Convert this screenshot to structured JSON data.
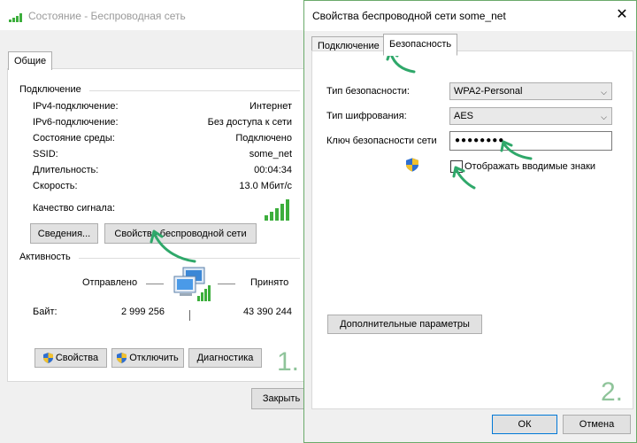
{
  "status_window": {
    "title": "Состояние - Беспроводная сеть",
    "tab_general": "Общие",
    "connection_group": "Подключение",
    "rows": [
      {
        "label": "IPv4-подключение:",
        "value": "Интернет"
      },
      {
        "label": "IPv6-подключение:",
        "value": "Без доступа к сети"
      },
      {
        "label": "Состояние среды:",
        "value": "Подключено"
      },
      {
        "label": "SSID:",
        "value": "some_net"
      },
      {
        "label": "Длительность:",
        "value": "00:04:34"
      },
      {
        "label": "Скорость:",
        "value": "13.0 Мбит/с"
      }
    ],
    "signal_label": "Качество сигнала:",
    "details_button": "Сведения...",
    "wireless_props_button": "Свойства беспроводной сети",
    "activity_group": "Активность",
    "sent_label": "Отправлено",
    "received_label": "Принято",
    "bytes_label": "Байт:",
    "bytes_sent": "2 999 256",
    "bytes_received": "43 390 244",
    "properties_button": "Свойства",
    "disconnect_button": "Отключить",
    "diagnostics_button": "Диагностика",
    "close_button": "Закрыть",
    "step_number": "1."
  },
  "props_dialog": {
    "title": "Свойства беспроводной сети some_net",
    "tab_connection": "Подключение",
    "tab_security": "Безопасность",
    "security_type_label": "Тип безопасности:",
    "security_type_value": "WPA2-Personal",
    "encryption_type_label": "Тип шифрования:",
    "encryption_type_value": "AES",
    "key_label": "Ключ безопасности сети",
    "key_value": "●●●●●●●●",
    "show_chars_label": "Отображать вводимые знаки",
    "advanced_button": "Дополнительные параметры",
    "ok_button": "ОК",
    "cancel_button": "Отмена",
    "step_number": "2."
  },
  "colors": {
    "accent_green": "#2fa86a",
    "signal_green": "#3cae3c",
    "step_number_color": "#8fc49a"
  }
}
